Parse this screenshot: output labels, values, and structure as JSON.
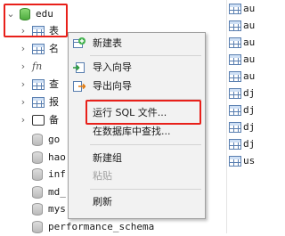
{
  "tree": {
    "root_db": "edu",
    "root_child": "表",
    "partial_items": [
      "名",
      "fn",
      "查",
      "报",
      "备"
    ],
    "databases": [
      "go",
      "hao",
      "inf",
      "md_",
      "mys",
      "performance_schema"
    ]
  },
  "right_list": [
    "au",
    "au",
    "au",
    "au",
    "au",
    "dj",
    "dj",
    "dj",
    "dj",
    "us"
  ],
  "context_menu": {
    "items": [
      {
        "label": "新建表",
        "icon": "new-table-icon",
        "enabled": true
      },
      {
        "label": "导入向导",
        "icon": "import-wizard-icon",
        "enabled": true
      },
      {
        "label": "导出向导",
        "icon": "export-wizard-icon",
        "enabled": true
      },
      {
        "label": "运行 SQL 文件...",
        "icon": "",
        "enabled": true
      },
      {
        "label": "在数据库中查找...",
        "icon": "",
        "enabled": true
      },
      {
        "label": "新建组",
        "icon": "",
        "enabled": true
      },
      {
        "label": "粘贴",
        "icon": "",
        "enabled": false
      },
      {
        "label": "刷新",
        "icon": "",
        "enabled": true
      }
    ]
  },
  "colors": {
    "highlight": "#e8201a",
    "db_active": "#4aa83b"
  }
}
